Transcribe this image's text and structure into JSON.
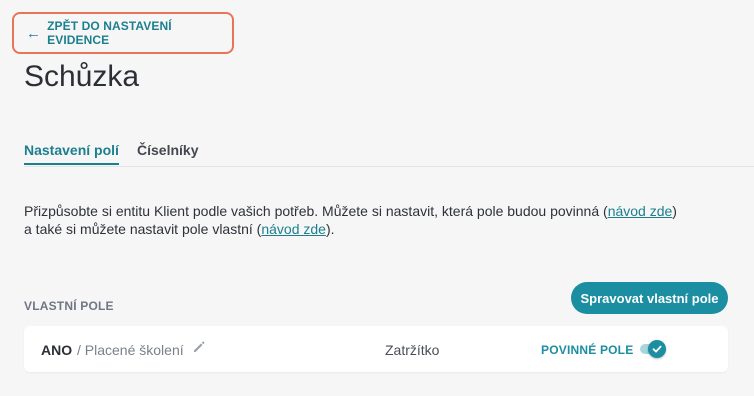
{
  "back_button": {
    "label": "ZPĚT DO NASTAVENÍ EVIDENCE",
    "icon": "arrow-left-icon"
  },
  "page": {
    "title": "Schůzka"
  },
  "tabs": [
    {
      "label": "Nastavení polí",
      "active": true
    },
    {
      "label": "Číselníky",
      "active": false
    }
  ],
  "description": {
    "part1": "Přizpůsobte si entitu Klient podle vašich potřeb. Můžete si nastavit, která pole budou povinná (",
    "link1": "návod zde",
    "part2": ") a také si můžete nastavit pole vlastní (",
    "link2": "návod zde",
    "part3": ")."
  },
  "custom_fields": {
    "section_label": "VLASTNÍ POLE",
    "manage_button": "Spravovat vlastní pole",
    "rows": [
      {
        "name": "ANO",
        "sub": "/ Placené školení",
        "type": "Zatržítko",
        "required_label": "POVINNÉ POLE",
        "required": true
      }
    ]
  },
  "colors": {
    "accent": "#1b8ea1",
    "focus_outline": "#e8745a"
  }
}
